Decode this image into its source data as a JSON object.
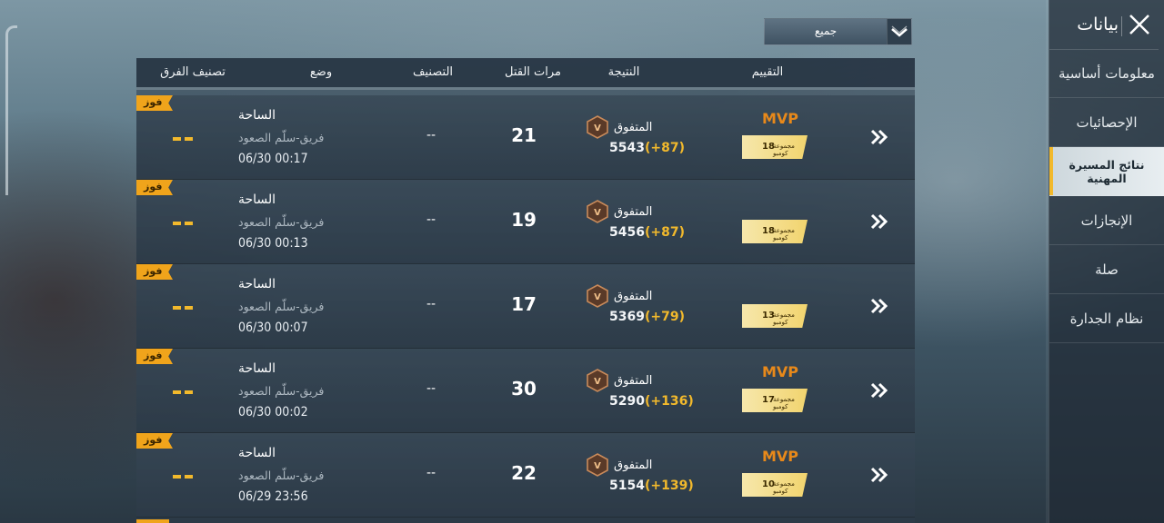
{
  "sidebar": {
    "title": "بيانات",
    "items": [
      {
        "label": "معلومات أساسية",
        "active": false
      },
      {
        "label": "الإحصائيات",
        "active": false
      },
      {
        "label": "نتائج المسيرة المهنية",
        "active": true
      },
      {
        "label": "الإنجازات",
        "active": false
      },
      {
        "label": "صلة",
        "active": false
      },
      {
        "label": "نظام الجدارة",
        "active": false
      }
    ]
  },
  "filter": {
    "selected": "جميع"
  },
  "table": {
    "headers": {
      "team_rank": "تصنيف الفرق",
      "mode": "وضع",
      "rank": "التصنيف",
      "kills": "مرات القتل",
      "result": "النتيجة",
      "rating": "التقييم"
    },
    "rows": [
      {
        "win": "فوز",
        "team_rank": "--",
        "mode": "الساحة",
        "sub": "فريق-سلّم الصعود",
        "date": "06/30 00:17",
        "rank": "--",
        "kills": "21",
        "tier": "المتفوق",
        "score": "5543",
        "delta": "(+87)",
        "mvp": "MVP",
        "combo_num": "18",
        "combo_text": "مجموعة كومبو"
      },
      {
        "win": "فوز",
        "team_rank": "--",
        "mode": "الساحة",
        "sub": "فريق-سلّم الصعود",
        "date": "06/30 00:13",
        "rank": "--",
        "kills": "19",
        "tier": "المتفوق",
        "score": "5456",
        "delta": "(+87)",
        "mvp": "",
        "combo_num": "18",
        "combo_text": "مجموعة كومبو"
      },
      {
        "win": "فوز",
        "team_rank": "--",
        "mode": "الساحة",
        "sub": "فريق-سلّم الصعود",
        "date": "06/30 00:07",
        "rank": "--",
        "kills": "17",
        "tier": "المتفوق",
        "score": "5369",
        "delta": "(+79)",
        "mvp": "",
        "combo_num": "13",
        "combo_text": "مجموعة كومبو"
      },
      {
        "win": "فوز",
        "team_rank": "--",
        "mode": "الساحة",
        "sub": "فريق-سلّم الصعود",
        "date": "06/30 00:02",
        "rank": "--",
        "kills": "30",
        "tier": "المتفوق",
        "score": "5290",
        "delta": "(+136)",
        "mvp": "MVP",
        "combo_num": "17",
        "combo_text": "مجموعة كومبو"
      },
      {
        "win": "فوز",
        "team_rank": "--",
        "mode": "الساحة",
        "sub": "فريق-سلّم الصعود",
        "date": "06/29 23:56",
        "rank": "--",
        "kills": "22",
        "tier": "المتفوق",
        "score": "5154",
        "delta": "(+139)",
        "mvp": "MVP",
        "combo_num": "10",
        "combo_text": "مجموعة كومبو"
      }
    ]
  },
  "colors": {
    "accent": "#f2b92c",
    "win_tag": "#f0a41b",
    "mvp": "#e8891a"
  },
  "icons": {
    "close": "close-icon",
    "dropdown": "chevron-down-icon",
    "row": "double-chevron-right-icon",
    "tier": "tier-badge-icon"
  }
}
